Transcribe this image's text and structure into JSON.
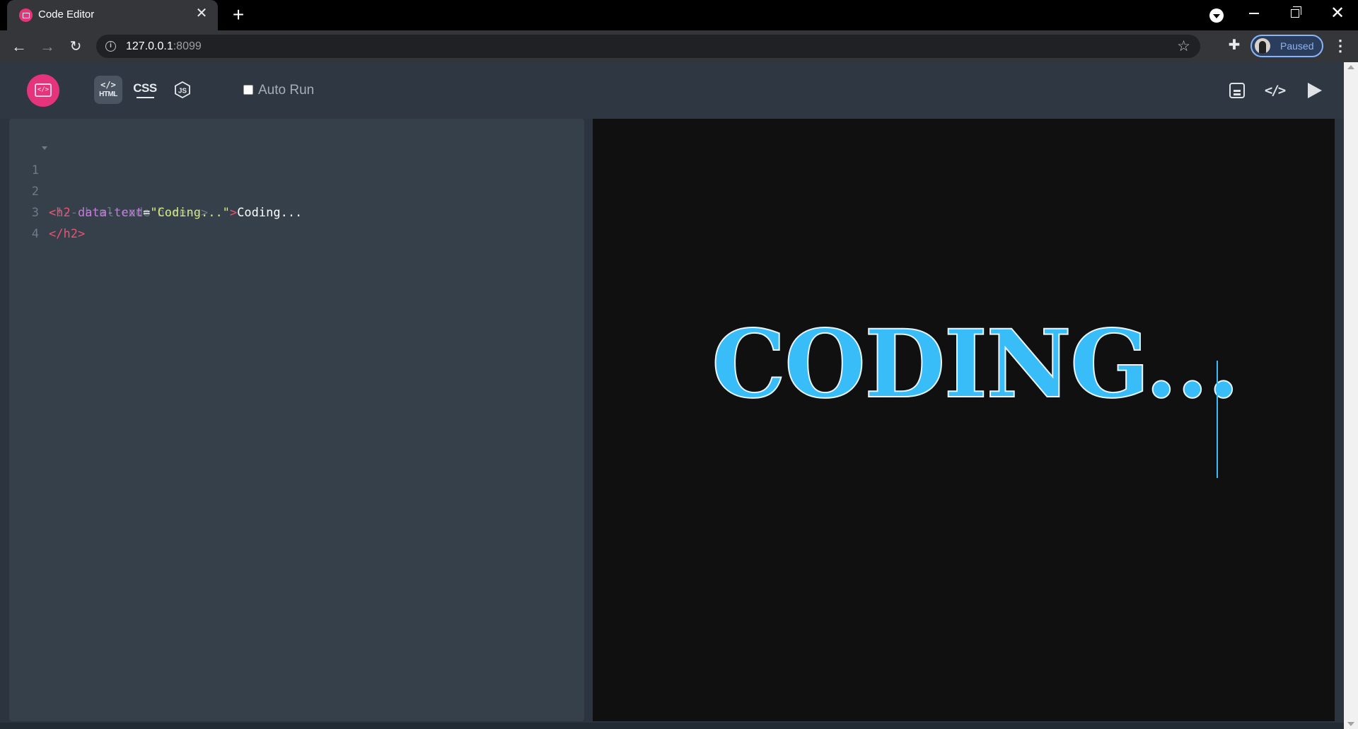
{
  "browser": {
    "tab_title": "Code Editor",
    "tab_close": "✕",
    "new_tab": "+",
    "url_host": "127.0.0.1",
    "url_port": ":8099",
    "profile_label": "Paused"
  },
  "app": {
    "logo_glyph": "</>",
    "tabs": [
      {
        "glyph": "</>",
        "label": "HTML",
        "active": true
      },
      {
        "label": "CSS"
      },
      {
        "label": "JS"
      }
    ],
    "autorun_label": "Auto Run",
    "autorun_checked": false,
    "code_button_glyph": "</>"
  },
  "editor": {
    "lines": [
      {
        "num": "1",
        "comment": "<!-- html code here-->"
      },
      {
        "num": "2",
        "open": "<h2 ",
        "attr": "data-text",
        "eq": "=",
        "str": "\"Coding...\"",
        "close": ">",
        "text": "Coding..."
      },
      {
        "num": "3",
        "tag": "</h2>"
      },
      {
        "num": "4"
      }
    ]
  },
  "preview": {
    "text": "CODING..."
  },
  "colors": {
    "accent": "#e5337c",
    "preview_text": "#38bdf8",
    "editor_bg": "#36404b",
    "preview_bg": "#101010"
  }
}
